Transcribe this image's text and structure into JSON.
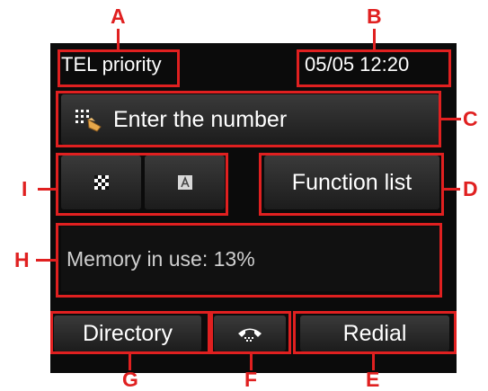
{
  "status_bar": {
    "mode": "TEL priority",
    "datetime": "05/05 12:20"
  },
  "buttons": {
    "enter_number": "Enter the number",
    "function_list": "Function list",
    "directory": "Directory",
    "redial": "Redial"
  },
  "memory": {
    "label": "Memory in use: 13%",
    "percent": 13
  },
  "callouts": [
    "A",
    "B",
    "C",
    "D",
    "E",
    "F",
    "G",
    "H",
    "I"
  ],
  "colors": {
    "callout": "#e02020",
    "screen_bg": "#0b0b0b",
    "button_bg": "#2a2a2a"
  },
  "icons": {
    "enter_number": "dial-pad-hand-icon",
    "quality_fine": "checker-icon",
    "quality_text": "letter-a-icon",
    "hook": "handset-icon"
  }
}
